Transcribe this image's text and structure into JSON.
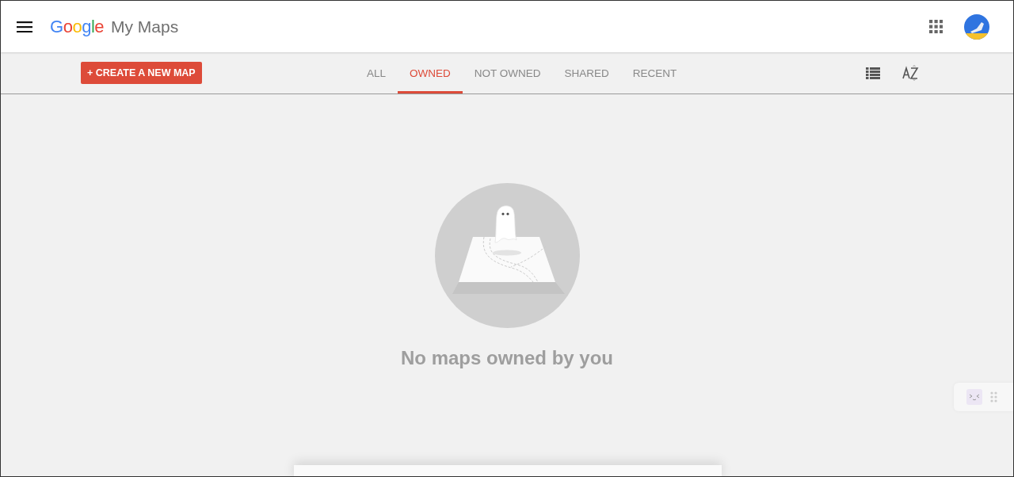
{
  "header": {
    "logo": {
      "brand": "Google",
      "product": "My Maps"
    }
  },
  "toolbar": {
    "create_button": "+ CREATE A NEW MAP",
    "tabs": [
      {
        "label": "ALL",
        "selected": false
      },
      {
        "label": "OWNED",
        "selected": true
      },
      {
        "label": "NOT OWNED",
        "selected": false
      },
      {
        "label": "SHARED",
        "selected": false
      },
      {
        "label": "RECENT",
        "selected": false
      }
    ]
  },
  "empty_state": {
    "message": "No maps owned by you"
  }
}
